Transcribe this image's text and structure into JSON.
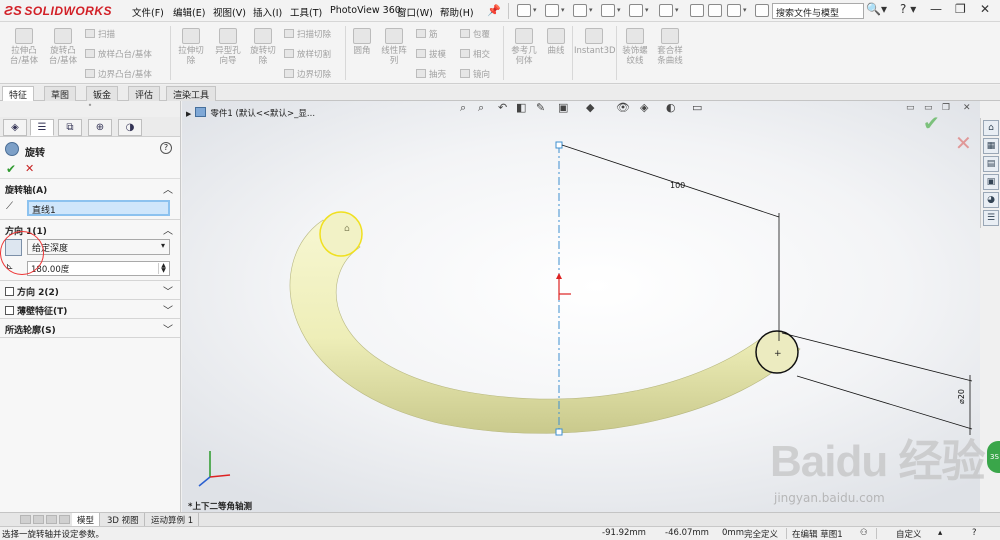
{
  "app": {
    "logo_text": "SOLIDWORKS",
    "menu": [
      "文件(F)",
      "编辑(E)",
      "视图(V)",
      "插入(I)",
      "工具(T)",
      "PhotoView 360",
      "窗口(W)",
      "帮助(H)"
    ],
    "search_placeholder": "搜索文件与模型",
    "help_label": "?"
  },
  "ribbon": {
    "big_buttons": [
      "拉伸凸\n台/基体",
      "旋转凸\n台/基体",
      "拉伸切\n除",
      "异型孔\n向导",
      "旋转切\n除",
      "圆角",
      "线性阵\n列",
      "参考几\n何体",
      "曲线",
      "Instant3D",
      "装饰螺\n纹线",
      "套合样\n条曲线"
    ],
    "small_buttons": [
      "扫描",
      "放样凸台/基体",
      "边界凸台/基体",
      "扫描切除",
      "放样切割",
      "边界切除",
      "筋",
      "拔模",
      "抽壳",
      "包覆",
      "相交",
      "镜向"
    ]
  },
  "tabs": [
    "特征",
    "草图",
    "钣金",
    "评估",
    "渲染工具"
  ],
  "property_manager": {
    "title": "旋转",
    "help": "?",
    "ok": "✔",
    "cancel": "✕",
    "axis_group": "旋转轴(A)",
    "axis_value": "直线1",
    "dir1_group": "方向 1(1)",
    "end_condition": "给定深度",
    "angle": "180.00度",
    "dir2_group": "方向 2(2)",
    "thin_group": "薄壁特征(T)",
    "contours_group": "所选轮廓(S)"
  },
  "viewport": {
    "tree_item": "零件1  (默认<<默认>_显...",
    "dim_length": "100",
    "dim_diameter": "⌀20",
    "view_label": "*上下二等角轴测"
  },
  "bottom_tabs": [
    "模型",
    "3D 视图",
    "运动算例 1"
  ],
  "status": {
    "message": "选择一旋转轴并设定参数。",
    "x": "-91.92mm",
    "y": "-46.07mm",
    "z": "0mm",
    "definition": "完全定义",
    "editing": "在编辑 草图1",
    "units": "自定义"
  },
  "watermark": {
    "big": "Baidu 经验",
    "small": "jingyan.baidu.com"
  },
  "colors": {
    "brand_red": "#d22027",
    "model_fill": "#eeeeb8",
    "axis_blue": "#3e8fd0",
    "selection_yellow": "#f0e020",
    "ok_green": "#2f9a2f",
    "cancel_red": "#c72020"
  }
}
